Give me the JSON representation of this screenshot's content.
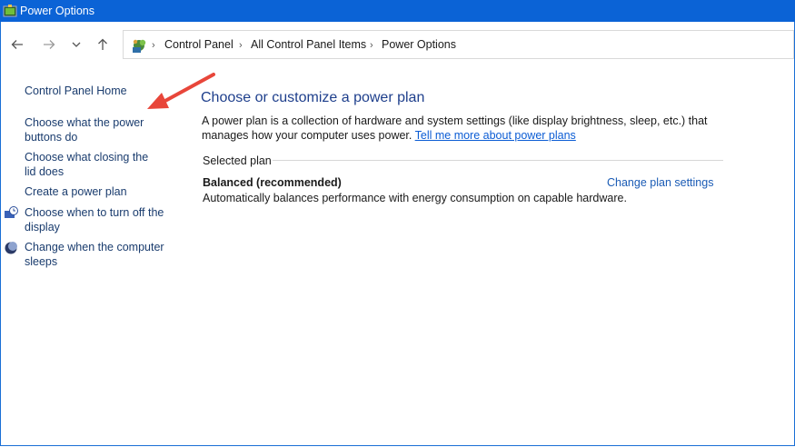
{
  "window": {
    "title": "Power Options"
  },
  "nav": {
    "back_icon": "back-arrow-icon",
    "forward_icon": "forward-arrow-icon",
    "recent_icon": "chevron-down-icon",
    "up_icon": "up-arrow-icon"
  },
  "breadcrumb": {
    "icon": "control-panel-icon",
    "items": [
      "Control Panel",
      "All Control Panel Items",
      "Power Options"
    ]
  },
  "sidebar": {
    "home": "Control Panel Home",
    "links": [
      "Choose what the power buttons do",
      "Choose what closing the lid does",
      "Create a power plan",
      "Choose when to turn off the display",
      "Change when the computer sleeps"
    ]
  },
  "main": {
    "heading": "Choose or customize a power plan",
    "description": "A power plan is a collection of hardware and system settings (like display brightness, sleep, etc.) that manages how your computer uses power.",
    "learn_more": "Tell me more about power plans",
    "selected_plan_label": "Selected plan",
    "plan_name": "Balanced (recommended)",
    "plan_description": "Automatically balances performance with energy consumption on capable hardware.",
    "change_plan": "Change plan settings"
  },
  "colors": {
    "titlebar": "#0b63d6",
    "heading": "#1e3f8c",
    "link": "#1a3c6e",
    "annotation_arrow": "#e8463a"
  }
}
